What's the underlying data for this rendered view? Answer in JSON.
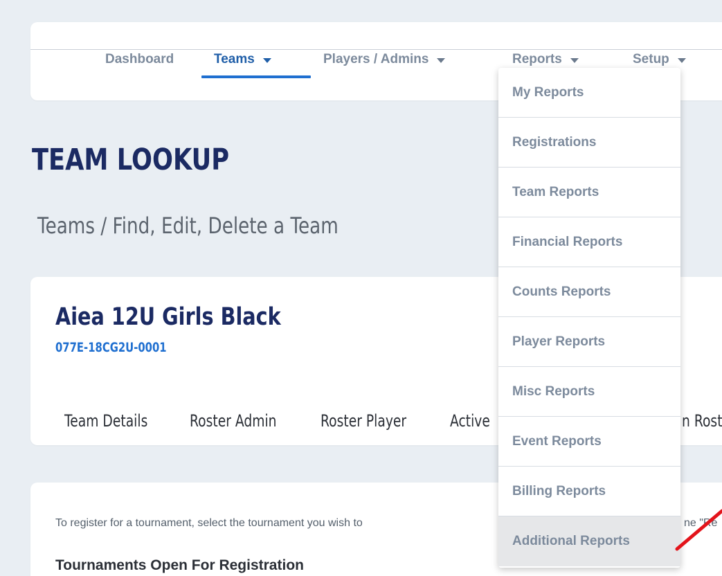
{
  "nav": {
    "items": [
      {
        "label": "Dashboard",
        "has_caret": false,
        "active": false
      },
      {
        "label": "Teams",
        "has_caret": true,
        "active": true
      },
      {
        "label": "Players / Admins",
        "has_caret": true,
        "active": false
      },
      {
        "label": "Reports",
        "has_caret": true,
        "active": false
      },
      {
        "label": "Setup",
        "has_caret": true,
        "active": false
      }
    ]
  },
  "page": {
    "title": "TEAM LOOKUP",
    "subtitle": "Teams / Find, Edit, Delete a Team"
  },
  "team": {
    "name": "Aiea 12U Girls Black",
    "code": "077E-18CG2U-0001",
    "tabs": [
      "Team Details",
      "Roster Admin",
      "Roster Player",
      "Active",
      "n Rost"
    ]
  },
  "registration": {
    "note_left": "To register for a tournament, select the tournament you wish to",
    "note_right": "ne \"Re",
    "heading": "Tournaments Open For Registration"
  },
  "reports_menu": {
    "items": [
      "My Reports",
      "Registrations",
      "Team Reports",
      "Financial Reports",
      "Counts Reports",
      "Player Reports",
      "Misc Reports",
      "Event Reports",
      "Billing Reports",
      "Additional Reports"
    ],
    "hovered_item": "Additional Reports"
  },
  "colors": {
    "background": "#e9eef3",
    "nav_text": "#7c8a9c",
    "nav_active": "#1f5ea8",
    "underline": "#1f6fd0",
    "title": "#1b2a63",
    "team_code": "#1f6fd0",
    "annotation": "#e3141b"
  }
}
